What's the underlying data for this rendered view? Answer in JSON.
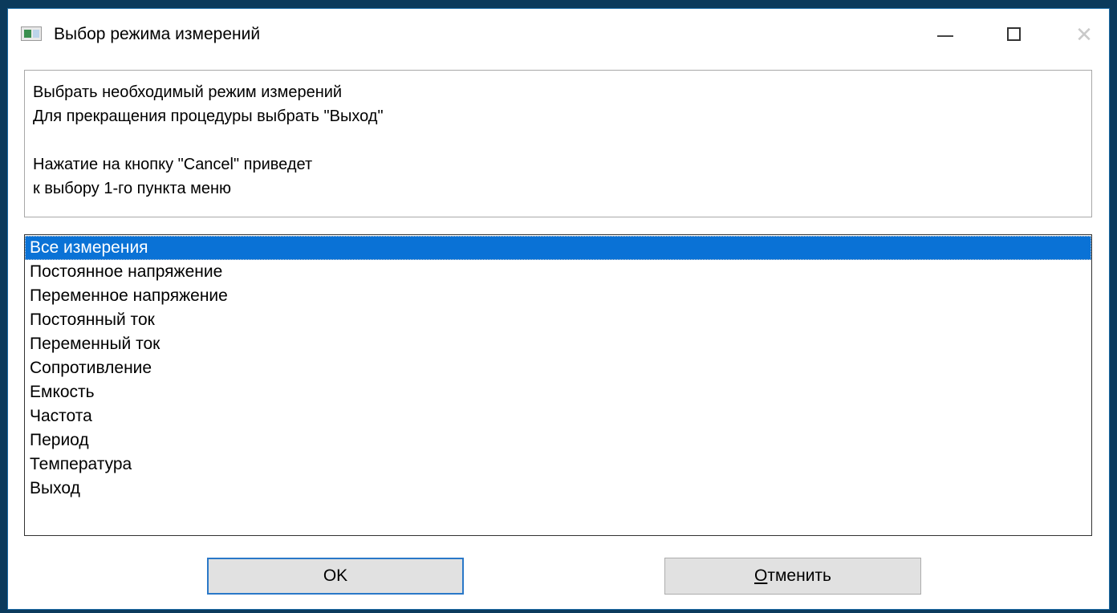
{
  "window": {
    "title": "Выбор режима измерений",
    "controls": {
      "minimize": "—",
      "maximize": "☐",
      "close": "✕"
    }
  },
  "message": {
    "lines": [
      "Выбрать необходимый режим измерений",
      "Для прекращения процедуры выбрать \"Выход\"",
      "",
      "Нажатие на кнопку \"Cancel\" приведет",
      "к выбору 1-го пункта меню"
    ]
  },
  "list": {
    "selected_index": 0,
    "items": [
      "Все измерения",
      "Постоянное напряжение",
      "Переменное напряжение",
      "Постоянный ток",
      "Переменный ток",
      "Сопротивление",
      "Емкость",
      "Частота",
      "Период",
      "Температура",
      "Выход"
    ]
  },
  "buttons": {
    "ok_label": "OK",
    "cancel_label": "Отменить"
  },
  "colors": {
    "selection": "#0a72d6",
    "ok_border": "#2a78c8"
  }
}
